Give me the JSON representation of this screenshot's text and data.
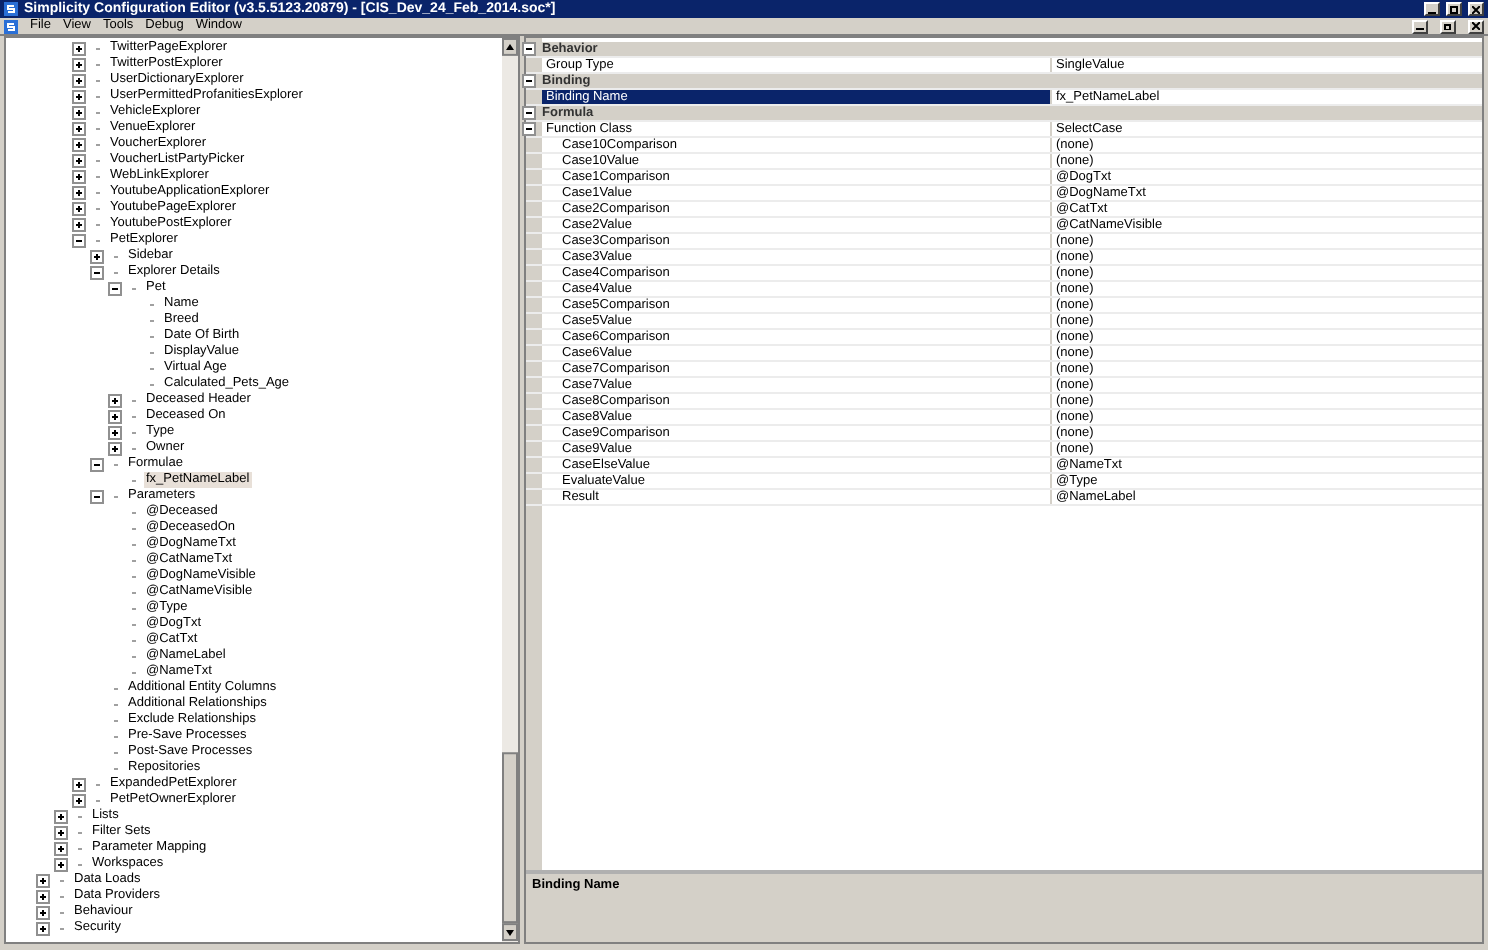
{
  "window": {
    "title": "Simplicity Configuration Editor (v3.5.5123.20879) - [CIS_Dev_24_Feb_2014.soc*]"
  },
  "menu": [
    "File",
    "View",
    "Tools",
    "Debug",
    "Window"
  ],
  "tree": {
    "continued": [
      {
        "label": "TwitterPageExplorer",
        "expanded": false,
        "selected": false
      },
      {
        "label": "TwitterPostExplorer",
        "expanded": false,
        "selected": false
      },
      {
        "label": "UserDictionaryExplorer",
        "expanded": false,
        "selected": false
      },
      {
        "label": "UserPermittedProfanitiesExplorer",
        "expanded": false,
        "selected": false
      },
      {
        "label": "VehicleExplorer",
        "expanded": false,
        "selected": false
      },
      {
        "label": "VenueExplorer",
        "expanded": false,
        "selected": false
      },
      {
        "label": "VoucherExplorer",
        "expanded": false,
        "selected": false
      },
      {
        "label": "VoucherListPartyPicker",
        "expanded": false,
        "selected": false
      },
      {
        "label": "WebLinkExplorer",
        "expanded": false,
        "selected": false
      },
      {
        "label": "YoutubeApplicationExplorer",
        "expanded": false,
        "selected": false
      },
      {
        "label": "YoutubePageExplorer",
        "expanded": false,
        "selected": false
      },
      {
        "label": "YoutubePostExplorer",
        "expanded": false,
        "selected": false
      },
      {
        "label": "PetExplorer",
        "expanded": true,
        "selected": false,
        "children": [
          {
            "label": "Sidebar",
            "expanded": false,
            "selected": false
          },
          {
            "label": "Explorer Details",
            "expanded": true,
            "selected": false,
            "children": [
              {
                "label": "Pet",
                "expanded": true,
                "selected": false,
                "children": [
                  {
                    "label": "Name",
                    "selected": false
                  },
                  {
                    "label": "Breed",
                    "selected": false
                  },
                  {
                    "label": "Date Of Birth",
                    "selected": false
                  },
                  {
                    "label": "DisplayValue",
                    "selected": false
                  },
                  {
                    "label": "Virtual Age",
                    "selected": false
                  },
                  {
                    "label": "Calculated_Pets_Age",
                    "selected": false
                  }
                ]
              },
              {
                "label": "Deceased Header",
                "expanded": false,
                "selected": false
              },
              {
                "label": "Deceased On",
                "expanded": false,
                "selected": false
              },
              {
                "label": "Type",
                "expanded": false,
                "selected": false
              },
              {
                "label": "Owner",
                "expanded": false,
                "selected": false
              }
            ]
          },
          {
            "label": "Formulae",
            "expanded": true,
            "selected": false,
            "children": [
              {
                "label": "fx_PetNameLabel",
                "selected": true
              }
            ]
          },
          {
            "label": "Parameters",
            "expanded": true,
            "selected": false,
            "children": [
              {
                "label": "@Deceased",
                "selected": false
              },
              {
                "label": "@DeceasedOn",
                "selected": false
              },
              {
                "label": "@DogNameTxt",
                "selected": false
              },
              {
                "label": "@CatNameTxt",
                "selected": false
              },
              {
                "label": "@DogNameVisible",
                "selected": false
              },
              {
                "label": "@CatNameVisible",
                "selected": false
              },
              {
                "label": "@Type",
                "selected": false
              },
              {
                "label": "@DogTxt",
                "selected": false
              },
              {
                "label": "@CatTxt",
                "selected": false
              },
              {
                "label": "@NameLabel",
                "selected": false
              },
              {
                "label": "@NameTxt",
                "selected": false
              }
            ]
          },
          {
            "label": "Additional Entity Columns",
            "selected": false
          },
          {
            "label": "Additional Relationships",
            "selected": false
          },
          {
            "label": "Exclude Relationships",
            "selected": false
          },
          {
            "label": "Pre-Save Processes",
            "selected": false
          },
          {
            "label": "Post-Save Processes",
            "selected": false
          },
          {
            "label": "Repositories",
            "selected": false
          }
        ]
      },
      {
        "label": "ExpandedPetExplorer",
        "expanded": false,
        "selected": false
      },
      {
        "label": "PetPetOwnerExplorer",
        "expanded": false,
        "selected": false
      }
    ],
    "sections": [
      {
        "label": "Lists",
        "expanded": false,
        "selected": false
      },
      {
        "label": "Filter Sets",
        "expanded": false,
        "selected": false
      },
      {
        "label": "Parameter Mapping",
        "expanded": false,
        "selected": false
      },
      {
        "label": "Workspaces",
        "expanded": false,
        "selected": false
      }
    ],
    "roots": [
      {
        "label": "Data Loads",
        "expanded": false,
        "selected": false
      },
      {
        "label": "Data Providers",
        "expanded": false,
        "selected": false
      },
      {
        "label": "Behaviour",
        "expanded": false,
        "selected": false
      },
      {
        "label": "Security",
        "expanded": false,
        "selected": false
      }
    ]
  },
  "property_grid": {
    "categories": [
      {
        "name": "Behavior",
        "expanded": true,
        "properties": [
          {
            "name": "Group Type",
            "value": "SingleValue",
            "selected": false
          }
        ]
      },
      {
        "name": "Binding",
        "expanded": true,
        "properties": [
          {
            "name": "Binding Name",
            "value": "fx_PetNameLabel",
            "selected": true
          }
        ]
      },
      {
        "name": "Formula",
        "expanded": true,
        "properties": [
          {
            "name": "Function Class",
            "value": "SelectCase",
            "selected": false,
            "expanded": true,
            "children": [
              {
                "name": "Case10Comparison",
                "value": "(none)",
                "selected": false
              },
              {
                "name": "Case10Value",
                "value": "(none)",
                "selected": false
              },
              {
                "name": "Case1Comparison",
                "value": "@DogTxt",
                "selected": false
              },
              {
                "name": "Case1Value",
                "value": "@DogNameTxt",
                "selected": false
              },
              {
                "name": "Case2Comparison",
                "value": "@CatTxt",
                "selected": false
              },
              {
                "name": "Case2Value",
                "value": "@CatNameVisible",
                "selected": false
              },
              {
                "name": "Case3Comparison",
                "value": "(none)",
                "selected": false
              },
              {
                "name": "Case3Value",
                "value": "(none)",
                "selected": false
              },
              {
                "name": "Case4Comparison",
                "value": "(none)",
                "selected": false
              },
              {
                "name": "Case4Value",
                "value": "(none)",
                "selected": false
              },
              {
                "name": "Case5Comparison",
                "value": "(none)",
                "selected": false
              },
              {
                "name": "Case5Value",
                "value": "(none)",
                "selected": false
              },
              {
                "name": "Case6Comparison",
                "value": "(none)",
                "selected": false
              },
              {
                "name": "Case6Value",
                "value": "(none)",
                "selected": false
              },
              {
                "name": "Case7Comparison",
                "value": "(none)",
                "selected": false
              },
              {
                "name": "Case7Value",
                "value": "(none)",
                "selected": false
              },
              {
                "name": "Case8Comparison",
                "value": "(none)",
                "selected": false
              },
              {
                "name": "Case8Value",
                "value": "(none)",
                "selected": false
              },
              {
                "name": "Case9Comparison",
                "value": "(none)",
                "selected": false
              },
              {
                "name": "Case9Value",
                "value": "(none)",
                "selected": false
              },
              {
                "name": "CaseElseValue",
                "value": "@NameTxt",
                "selected": false
              },
              {
                "name": "EvaluateValue",
                "value": "@Type",
                "selected": false
              },
              {
                "name": "Result",
                "value": "@NameLabel",
                "selected": false
              }
            ]
          }
        ]
      }
    ],
    "description": {
      "title": "Binding Name"
    }
  }
}
